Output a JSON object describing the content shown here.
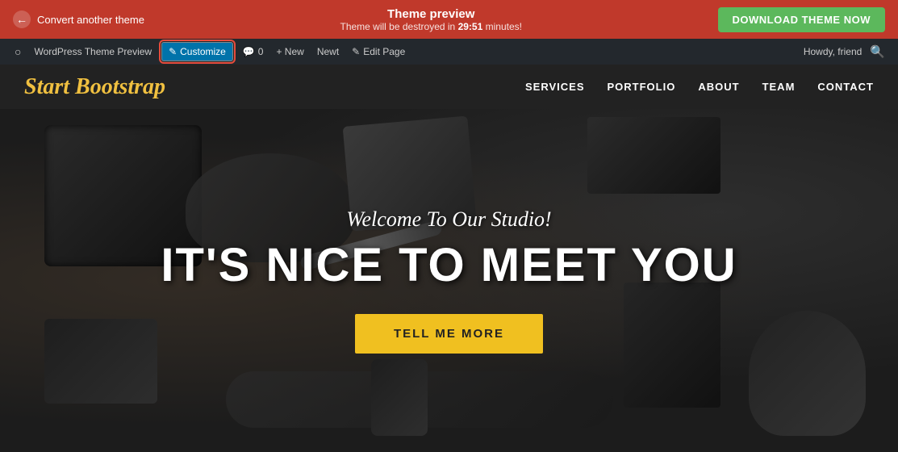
{
  "banner": {
    "convert_label": "Convert another theme",
    "title": "Theme preview",
    "subtitle_pre": "Theme will be destroyed in ",
    "timer": "29:51",
    "subtitle_post": " minutes!",
    "download_label": "DOWNLOAD THEME NOW",
    "colors": {
      "banner_bg": "#c0392b",
      "download_bg": "#5cb85c"
    }
  },
  "admin_bar": {
    "wp_icon": "⊞",
    "theme_preview_label": "WordPress Theme Preview",
    "customize_label": "Customize",
    "comment_icon": "💬",
    "comment_count": "0",
    "new_label": "+ New",
    "new_sub_label": "Newt",
    "edit_label": "Edit Page",
    "howdy_label": "Howdy, friend",
    "search_icon": "🔍"
  },
  "nav": {
    "site_title": "Start Bootstrap",
    "links": [
      "SERVICES",
      "PORTFOLIO",
      "ABOUT",
      "TEAM",
      "CONTACT"
    ]
  },
  "hero": {
    "subtitle": "Welcome To Our Studio!",
    "title": "IT'S NICE TO MEET YOU",
    "cta_label": "TELL ME MORE"
  }
}
